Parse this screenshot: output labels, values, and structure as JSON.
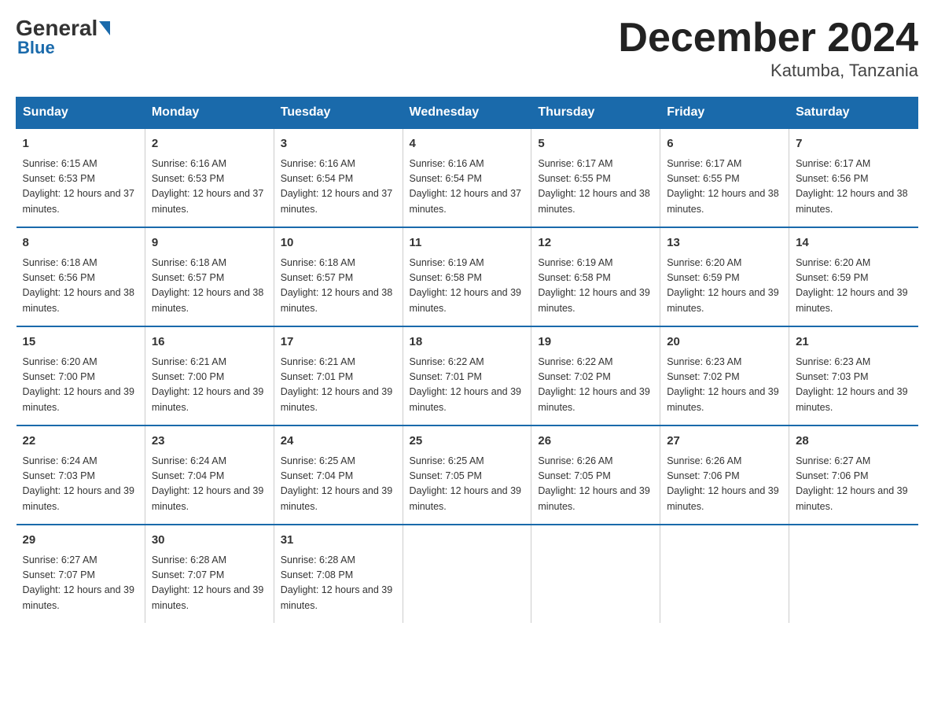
{
  "header": {
    "logo_general": "General",
    "logo_blue": "Blue",
    "month_title": "December 2024",
    "location": "Katumba, Tanzania"
  },
  "days_of_week": [
    "Sunday",
    "Monday",
    "Tuesday",
    "Wednesday",
    "Thursday",
    "Friday",
    "Saturday"
  ],
  "weeks": [
    [
      {
        "day": "1",
        "sunrise": "6:15 AM",
        "sunset": "6:53 PM",
        "daylight": "12 hours and 37 minutes."
      },
      {
        "day": "2",
        "sunrise": "6:16 AM",
        "sunset": "6:53 PM",
        "daylight": "12 hours and 37 minutes."
      },
      {
        "day": "3",
        "sunrise": "6:16 AM",
        "sunset": "6:54 PM",
        "daylight": "12 hours and 37 minutes."
      },
      {
        "day": "4",
        "sunrise": "6:16 AM",
        "sunset": "6:54 PM",
        "daylight": "12 hours and 37 minutes."
      },
      {
        "day": "5",
        "sunrise": "6:17 AM",
        "sunset": "6:55 PM",
        "daylight": "12 hours and 38 minutes."
      },
      {
        "day": "6",
        "sunrise": "6:17 AM",
        "sunset": "6:55 PM",
        "daylight": "12 hours and 38 minutes."
      },
      {
        "day": "7",
        "sunrise": "6:17 AM",
        "sunset": "6:56 PM",
        "daylight": "12 hours and 38 minutes."
      }
    ],
    [
      {
        "day": "8",
        "sunrise": "6:18 AM",
        "sunset": "6:56 PM",
        "daylight": "12 hours and 38 minutes."
      },
      {
        "day": "9",
        "sunrise": "6:18 AM",
        "sunset": "6:57 PM",
        "daylight": "12 hours and 38 minutes."
      },
      {
        "day": "10",
        "sunrise": "6:18 AM",
        "sunset": "6:57 PM",
        "daylight": "12 hours and 38 minutes."
      },
      {
        "day": "11",
        "sunrise": "6:19 AM",
        "sunset": "6:58 PM",
        "daylight": "12 hours and 39 minutes."
      },
      {
        "day": "12",
        "sunrise": "6:19 AM",
        "sunset": "6:58 PM",
        "daylight": "12 hours and 39 minutes."
      },
      {
        "day": "13",
        "sunrise": "6:20 AM",
        "sunset": "6:59 PM",
        "daylight": "12 hours and 39 minutes."
      },
      {
        "day": "14",
        "sunrise": "6:20 AM",
        "sunset": "6:59 PM",
        "daylight": "12 hours and 39 minutes."
      }
    ],
    [
      {
        "day": "15",
        "sunrise": "6:20 AM",
        "sunset": "7:00 PM",
        "daylight": "12 hours and 39 minutes."
      },
      {
        "day": "16",
        "sunrise": "6:21 AM",
        "sunset": "7:00 PM",
        "daylight": "12 hours and 39 minutes."
      },
      {
        "day": "17",
        "sunrise": "6:21 AM",
        "sunset": "7:01 PM",
        "daylight": "12 hours and 39 minutes."
      },
      {
        "day": "18",
        "sunrise": "6:22 AM",
        "sunset": "7:01 PM",
        "daylight": "12 hours and 39 minutes."
      },
      {
        "day": "19",
        "sunrise": "6:22 AM",
        "sunset": "7:02 PM",
        "daylight": "12 hours and 39 minutes."
      },
      {
        "day": "20",
        "sunrise": "6:23 AM",
        "sunset": "7:02 PM",
        "daylight": "12 hours and 39 minutes."
      },
      {
        "day": "21",
        "sunrise": "6:23 AM",
        "sunset": "7:03 PM",
        "daylight": "12 hours and 39 minutes."
      }
    ],
    [
      {
        "day": "22",
        "sunrise": "6:24 AM",
        "sunset": "7:03 PM",
        "daylight": "12 hours and 39 minutes."
      },
      {
        "day": "23",
        "sunrise": "6:24 AM",
        "sunset": "7:04 PM",
        "daylight": "12 hours and 39 minutes."
      },
      {
        "day": "24",
        "sunrise": "6:25 AM",
        "sunset": "7:04 PM",
        "daylight": "12 hours and 39 minutes."
      },
      {
        "day": "25",
        "sunrise": "6:25 AM",
        "sunset": "7:05 PM",
        "daylight": "12 hours and 39 minutes."
      },
      {
        "day": "26",
        "sunrise": "6:26 AM",
        "sunset": "7:05 PM",
        "daylight": "12 hours and 39 minutes."
      },
      {
        "day": "27",
        "sunrise": "6:26 AM",
        "sunset": "7:06 PM",
        "daylight": "12 hours and 39 minutes."
      },
      {
        "day": "28",
        "sunrise": "6:27 AM",
        "sunset": "7:06 PM",
        "daylight": "12 hours and 39 minutes."
      }
    ],
    [
      {
        "day": "29",
        "sunrise": "6:27 AM",
        "sunset": "7:07 PM",
        "daylight": "12 hours and 39 minutes."
      },
      {
        "day": "30",
        "sunrise": "6:28 AM",
        "sunset": "7:07 PM",
        "daylight": "12 hours and 39 minutes."
      },
      {
        "day": "31",
        "sunrise": "6:28 AM",
        "sunset": "7:08 PM",
        "daylight": "12 hours and 39 minutes."
      },
      null,
      null,
      null,
      null
    ]
  ]
}
